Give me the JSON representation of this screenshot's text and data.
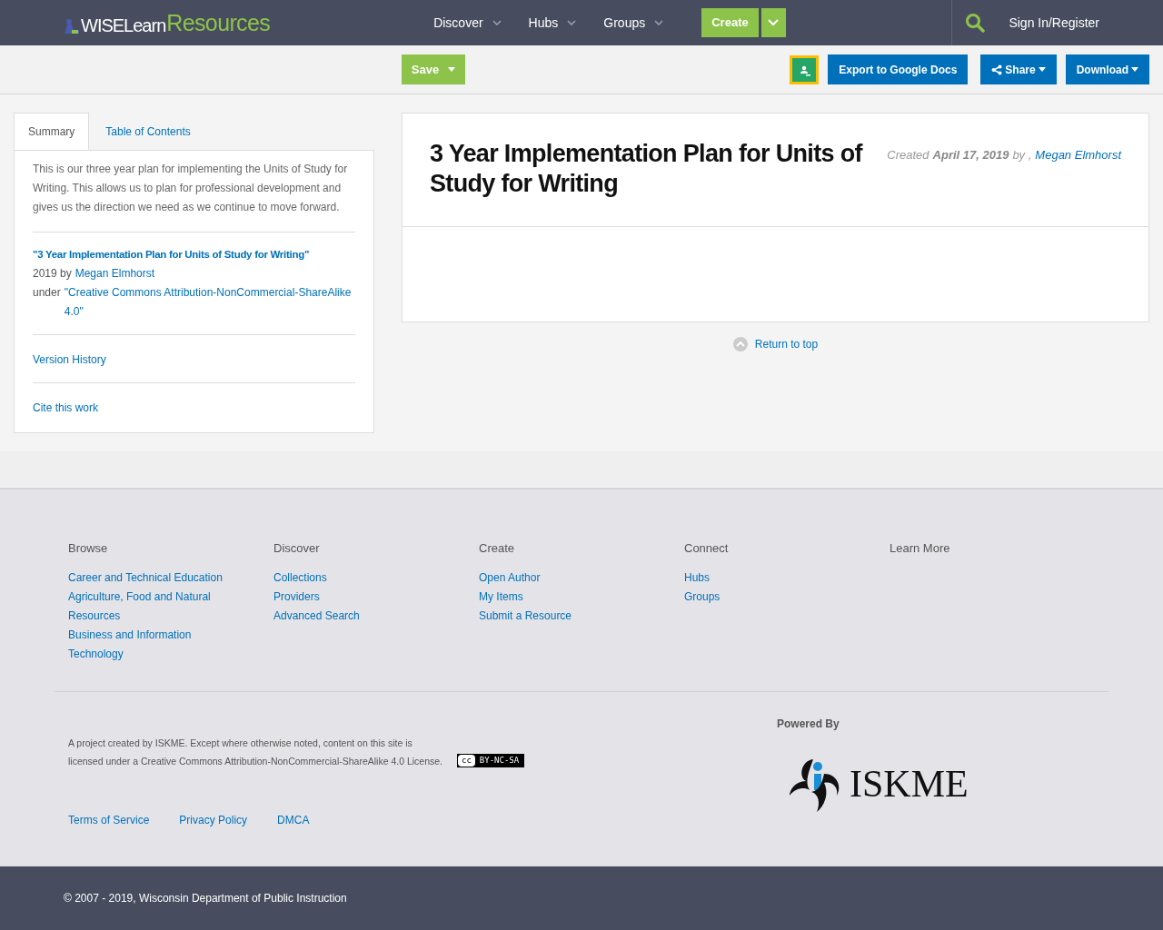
{
  "header": {
    "logo_main": "WISELearn",
    "logo_accent": "Resources",
    "nav": [
      {
        "label": "Discover"
      },
      {
        "label": "Hubs"
      },
      {
        "label": "Groups"
      }
    ],
    "create": "Create",
    "sign_in": "Sign In/Register"
  },
  "toolbar": {
    "save": "Save",
    "export": "Export to Google Docs",
    "share": "Share",
    "download": "Download"
  },
  "sidebar": {
    "tabs": [
      {
        "label": "Summary",
        "selected": true
      },
      {
        "label": "Table of Contents",
        "selected": false
      }
    ],
    "summary": "This is our three year plan for implementing the Units of Study for Writing. This allows us to plan for professional development and gives us the direction we need as we continue to move forward.",
    "attribution": {
      "title": "\"3 Year Implementation Plan for Units of Study for Writing\"",
      "year_by": "2019 by",
      "author": "Megan Elmhorst",
      "under": "under",
      "license": "\"Creative Commons Attribution-NonCommercial-ShareAlike 4.0\""
    },
    "links": [
      "Version History",
      "Cite this work"
    ]
  },
  "resource": {
    "title": "3 Year Implementation Plan for Units of Study for Writing",
    "created": "Created",
    "date": "April 17, 2019",
    "by": "by ,",
    "author": "Megan Elmhorst"
  },
  "return_to_top": "Return to top",
  "footer": {
    "columns": [
      {
        "heading": "Browse",
        "links": [
          "Career and Technical Education",
          "Agriculture, Food and Natural Resources",
          "Business and Information Technology"
        ]
      },
      {
        "heading": "Discover",
        "links": [
          "Collections",
          "Providers",
          "Advanced Search"
        ]
      },
      {
        "heading": "Create",
        "links": [
          "Open Author",
          "My Items",
          "Submit a Resource"
        ]
      },
      {
        "heading": "Connect",
        "links": [
          "Hubs",
          "Groups"
        ]
      },
      {
        "heading": "Learn More"
      }
    ],
    "notice": "A project created by ISKME. Except where otherwise noted, content on this site is licensed under a Creative Commons Attribution-NonCommercial-ShareAlike 4.0 License.",
    "cc_badge": {
      "cc": "cc",
      "terms": "BY-NC-SA"
    },
    "powered_by": "Powered By",
    "iskme": "ISKME",
    "legal_links": [
      "Terms of Service",
      "Privacy Policy",
      "DMCA"
    ],
    "copyright": "© 2007 - 2019, Wisconsin Department of Public Instruction"
  }
}
